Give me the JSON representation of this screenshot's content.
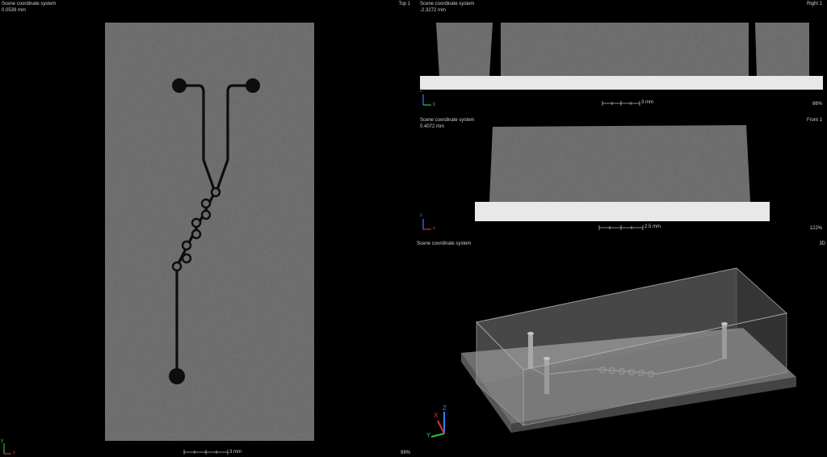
{
  "viewports": {
    "top": {
      "coord_system": "Scene coordinate system",
      "depth": "0.0539 mm",
      "view_name": "Top 1",
      "scale_label": "3 mm",
      "zoom": "99%",
      "axis_y": "y",
      "axis_x": "x"
    },
    "right": {
      "coord_system": "Scene coordinate system",
      "depth": "-2.3272 mm",
      "view_name": "Right 1",
      "scale_label": "3 mm",
      "zoom": "86%",
      "axis_vertical": "z",
      "axis_horizontal": "y"
    },
    "front": {
      "coord_system": "Scene coordinate system",
      "depth": "0.4072 mm",
      "view_name": "Front 1",
      "scale_label": "2.5 mm",
      "zoom": "122%",
      "axis_vertical": "z",
      "axis_horizontal": "x"
    },
    "perspective": {
      "coord_system": "Scene coordinate system",
      "view_name": "3D",
      "axis_z": "Z",
      "axis_x": "X",
      "axis_y": "Y"
    }
  },
  "colors": {
    "sample_gray": "#6b6b6b",
    "substrate_white": "#e8e8e8",
    "channel_dark": "#0d0d0d",
    "axis_red": "#e03030",
    "axis_green": "#30c040",
    "axis_blue": "#3080ff"
  }
}
